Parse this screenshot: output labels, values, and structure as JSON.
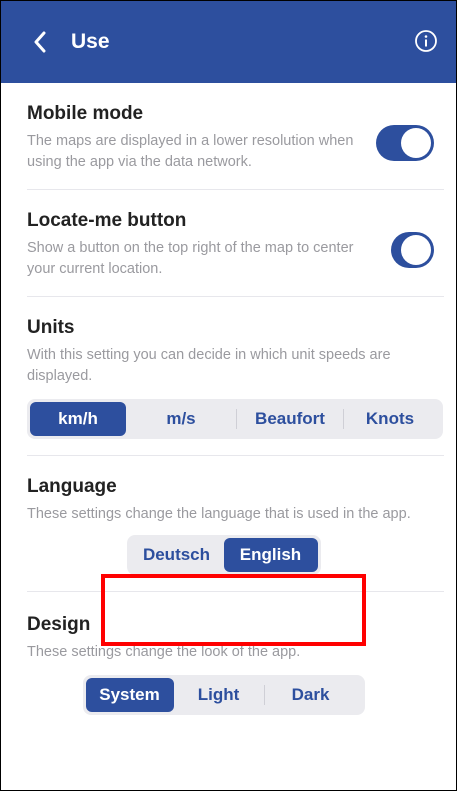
{
  "header": {
    "title": "Use",
    "back_icon": "chevron-left-icon",
    "info_icon": "info-circle-icon",
    "bg_color": "#2d4f9e"
  },
  "sections": {
    "mobile_mode": {
      "title": "Mobile mode",
      "description": "The maps are displayed in a lower resolution when using the app via the data network.",
      "enabled": true
    },
    "locate_me": {
      "title": "Locate-me button",
      "description": "Show a button on the top right of the map to center your current location.",
      "enabled": true
    },
    "units": {
      "title": "Units",
      "description": "With this setting you can decide in which unit speeds are displayed.",
      "options": [
        "km/h",
        "m/s",
        "Beaufort",
        "Knots"
      ],
      "selected": "km/h"
    },
    "language": {
      "title": "Language",
      "description": "These settings change the language that is used in the app.",
      "options": [
        "Deutsch",
        "English"
      ],
      "selected": "English"
    },
    "design": {
      "title": "Design",
      "description": "These settings change the look of the app.",
      "options": [
        "System",
        "Light",
        "Dark"
      ],
      "selected": "System"
    }
  },
  "highlight_color": "#ff0000"
}
